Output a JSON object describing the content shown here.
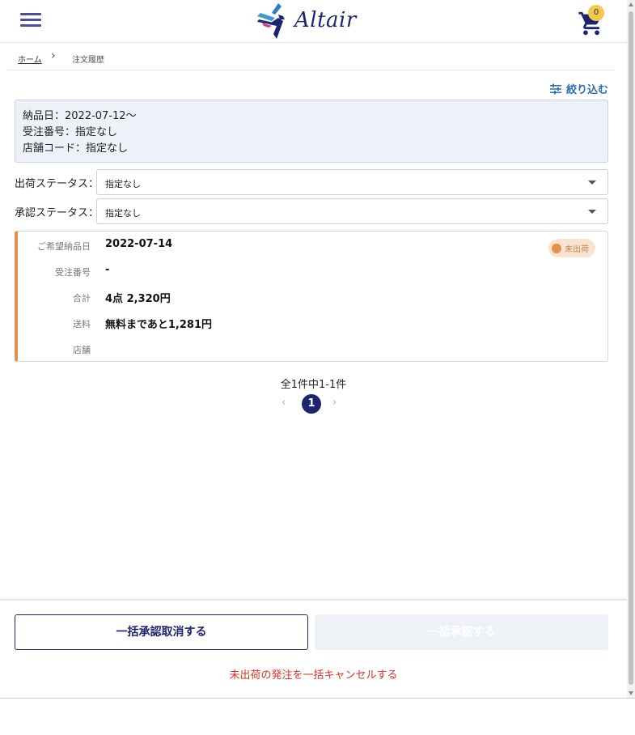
{
  "header": {
    "logo_text": "Altair",
    "cart_count": "0"
  },
  "breadcrumb": {
    "home": "ホーム",
    "separator": "›",
    "current": "注文履歴"
  },
  "filter": {
    "label": "絞り込む"
  },
  "summary": {
    "line1": "納品日：2022-07-12〜",
    "line2": "受注番号：指定なし",
    "line3": "店舗コード：指定なし"
  },
  "shipping_status": {
    "label": "出荷ステータス：",
    "value": "指定なし"
  },
  "approval_status": {
    "label": "承認ステータス：",
    "value": "指定なし"
  },
  "order": {
    "badge": "未出荷",
    "rows": [
      {
        "label": "ご希望納品日",
        "value": "2022-07-14"
      },
      {
        "label": "受注番号",
        "value": "-"
      },
      {
        "label": "合計",
        "value": "4点 2,320円"
      },
      {
        "label": "送料",
        "value": "無料まであと1,281円"
      },
      {
        "label": "店舗",
        "value": ""
      }
    ]
  },
  "pagination": {
    "summary": "全1件中1-1件",
    "prev": "‹",
    "current": "1",
    "next": "›"
  },
  "footer": {
    "cancel_approve_label": "一括承認取消する",
    "approve_label": "一括承認する",
    "cancel_orders_label": "未出荷の発注を一括キャンセルする"
  },
  "colors": {
    "brand": "#1f2470",
    "accent_blue": "#2b6cb0",
    "status_orange": "#e0914a",
    "danger": "#d93025"
  }
}
